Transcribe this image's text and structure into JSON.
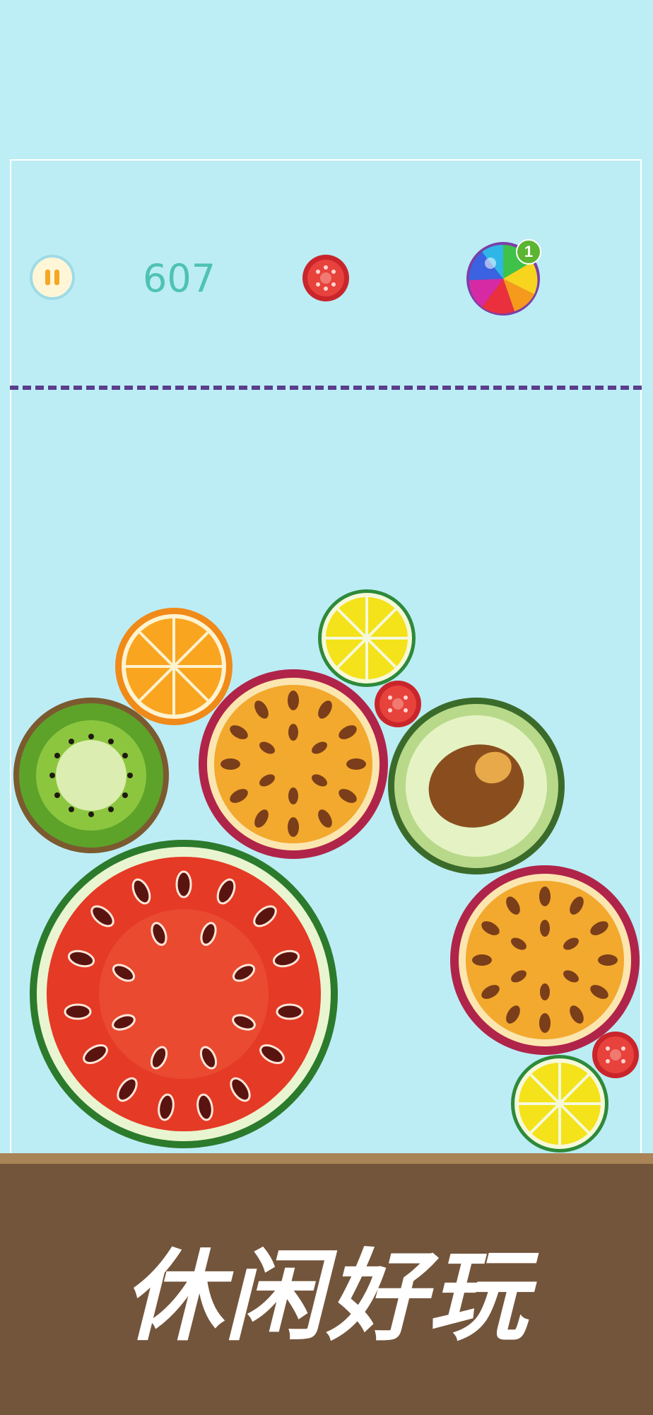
{
  "hud": {
    "score": "607",
    "next_fruit": "tomato",
    "bomb_count": "1"
  },
  "icons": {
    "pause": "pause-icon",
    "bomb": "rainbow-bomb-icon"
  },
  "colors": {
    "sky": "#bdeef6",
    "score_text": "#4ec2b5",
    "danger_line": "#5a3e8c",
    "ground": "#73553c",
    "ground_edge": "#a88456"
  },
  "fruits": [
    {
      "kind": "watermelon"
    },
    {
      "kind": "kiwi"
    },
    {
      "kind": "orange"
    },
    {
      "kind": "lemon"
    },
    {
      "kind": "passion-fruit"
    },
    {
      "kind": "tomato"
    },
    {
      "kind": "avocado"
    },
    {
      "kind": "passion-fruit"
    },
    {
      "kind": "tomato"
    },
    {
      "kind": "lemon"
    }
  ],
  "banner": {
    "slogan": "休闲好玩"
  }
}
